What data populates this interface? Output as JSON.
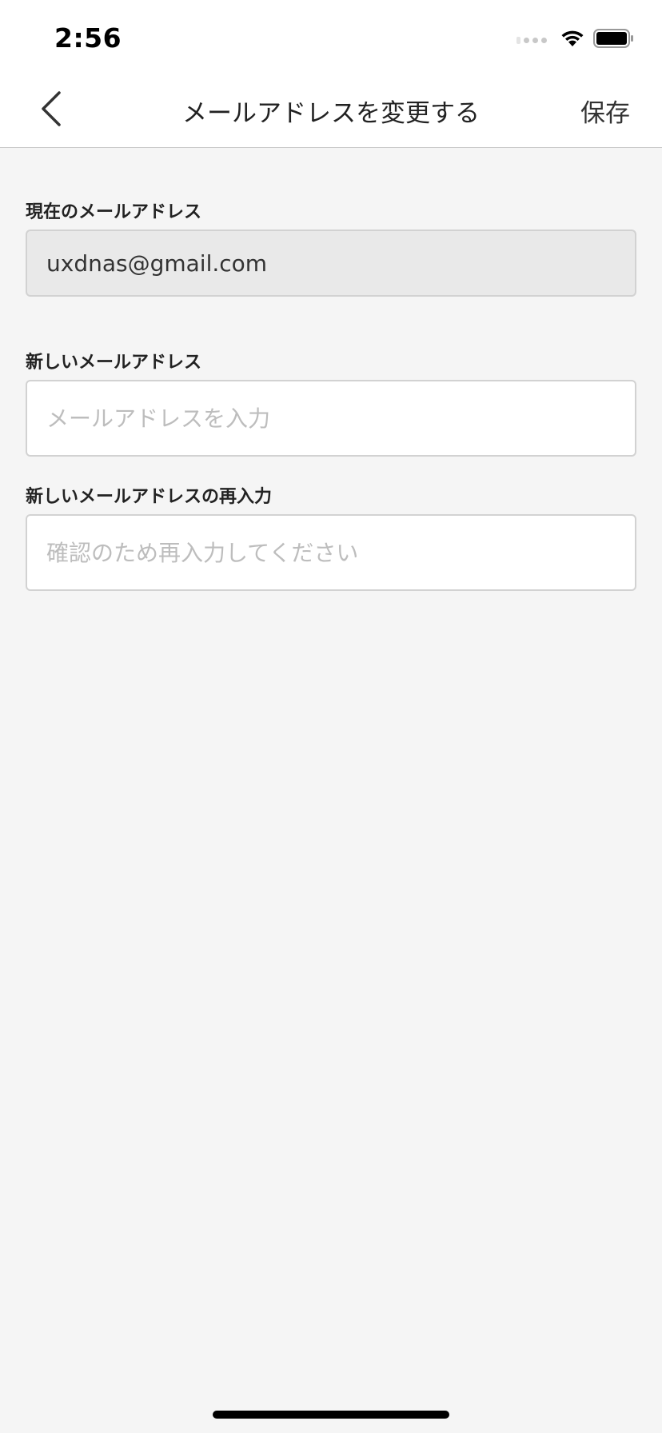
{
  "status_bar": {
    "time": "2:56"
  },
  "nav": {
    "back_icon": "chevron-left-icon",
    "title": "メールアドレスを変更する",
    "save_label": "保存"
  },
  "form": {
    "current_email": {
      "label": "現在のメールアドレス",
      "value": "uxdnas@gmail.com"
    },
    "new_email": {
      "label": "新しいメールアドレス",
      "placeholder": "メールアドレスを入力",
      "value": ""
    },
    "confirm_email": {
      "label": "新しいメールアドレスの再入力",
      "placeholder": "確認のため再入力してください",
      "value": ""
    }
  },
  "colors": {
    "background": "#f5f5f5",
    "header": "#ffffff",
    "readonly_field": "#e9e9e9",
    "placeholder": "#bdbdbd"
  }
}
